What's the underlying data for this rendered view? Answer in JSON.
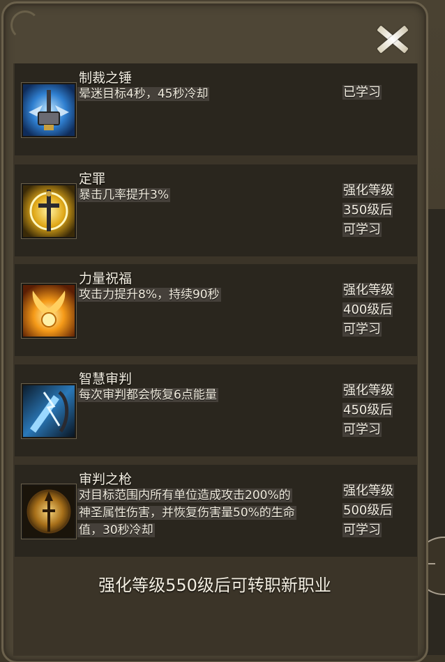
{
  "skills": [
    {
      "name": "制裁之锤",
      "desc_lines": [
        "晕迷目标4秒，45秒冷却"
      ],
      "status_lines": [
        "已学习"
      ],
      "icon": "hammer-icon",
      "icon_color": "#3a8ad8"
    },
    {
      "name": "定罪",
      "desc_lines": [
        "暴击几率提升3%"
      ],
      "status_lines": [
        "强化等级",
        "350级后",
        "可学习"
      ],
      "icon": "sword-icon",
      "icon_color": "#e0b020"
    },
    {
      "name": "力量祝福",
      "desc_lines": [
        "攻击力提升8%，持续90秒"
      ],
      "status_lines": [
        "强化等级",
        "400级后",
        "可学习"
      ],
      "icon": "winged-orb-icon",
      "icon_color": "#f09a18"
    },
    {
      "name": "智慧审判",
      "desc_lines": [
        "每次审判都会恢复6点能量"
      ],
      "status_lines": [
        "强化等级",
        "450级后",
        "可学习"
      ],
      "icon": "lightning-blade-icon",
      "icon_color": "#3aa0d8"
    },
    {
      "name": "审判之枪",
      "desc_lines": [
        "对目标范围内所有单位造成攻击200%的",
        "神圣属性伤害，并恢复伤害量50%的生命",
        "值，30秒冷却"
      ],
      "status_lines": [
        "强化等级",
        "500级后",
        "可学习"
      ],
      "icon": "spear-shield-icon",
      "icon_color": "#c8901c"
    }
  ],
  "footer": "强化等级550级后可转职新职业"
}
